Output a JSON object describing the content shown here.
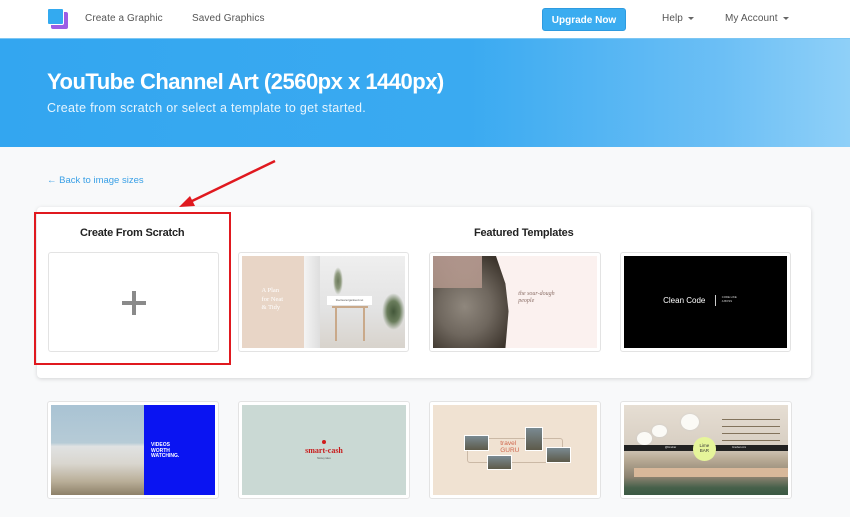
{
  "nav": {
    "logo_icon": "stacked-squares-logo",
    "links": [
      "Create a Graphic",
      "Saved Graphics"
    ],
    "upgrade_label": "Upgrade Now",
    "help_label": "Help",
    "account_label": "My Account",
    "accent_color": "#3aacf0"
  },
  "hero": {
    "title": "YouTube Channel Art (2560px x 1440px)",
    "subtitle": "Create from scratch or select a template to get started."
  },
  "back_link": "← Back to image sizes",
  "scratch": {
    "title": "Create From Scratch",
    "icon": "plus-icon"
  },
  "featured": {
    "title": "Featured Templates",
    "templates": [
      {
        "name": "plan-neat-tidy",
        "text": [
          "A Plan",
          "for Neat",
          "& Tidy"
        ],
        "label": "thecleanorganised.net"
      },
      {
        "name": "sourdough-people",
        "text": [
          "the sour-dough",
          "people"
        ]
      },
      {
        "name": "clean-code",
        "text": "Clean Code",
        "small": [
          "CODE LIKE",
          "A BOSS"
        ]
      }
    ]
  },
  "more_templates": [
    {
      "name": "videos-worth-watching",
      "text": [
        "VIDEOS",
        "WORTH",
        "WATCHING."
      ]
    },
    {
      "name": "smart-cash",
      "text": "smart-cash",
      "sub": "Money tales"
    },
    {
      "name": "travel-guru",
      "text": [
        "travel",
        "GURU"
      ]
    },
    {
      "name": "lime-bar",
      "text": [
        "Lime",
        "BAR"
      ],
      "left": "@limebar",
      "right": "limebar.com"
    }
  ],
  "annotation": {
    "highlight_color": "#e0191f"
  }
}
